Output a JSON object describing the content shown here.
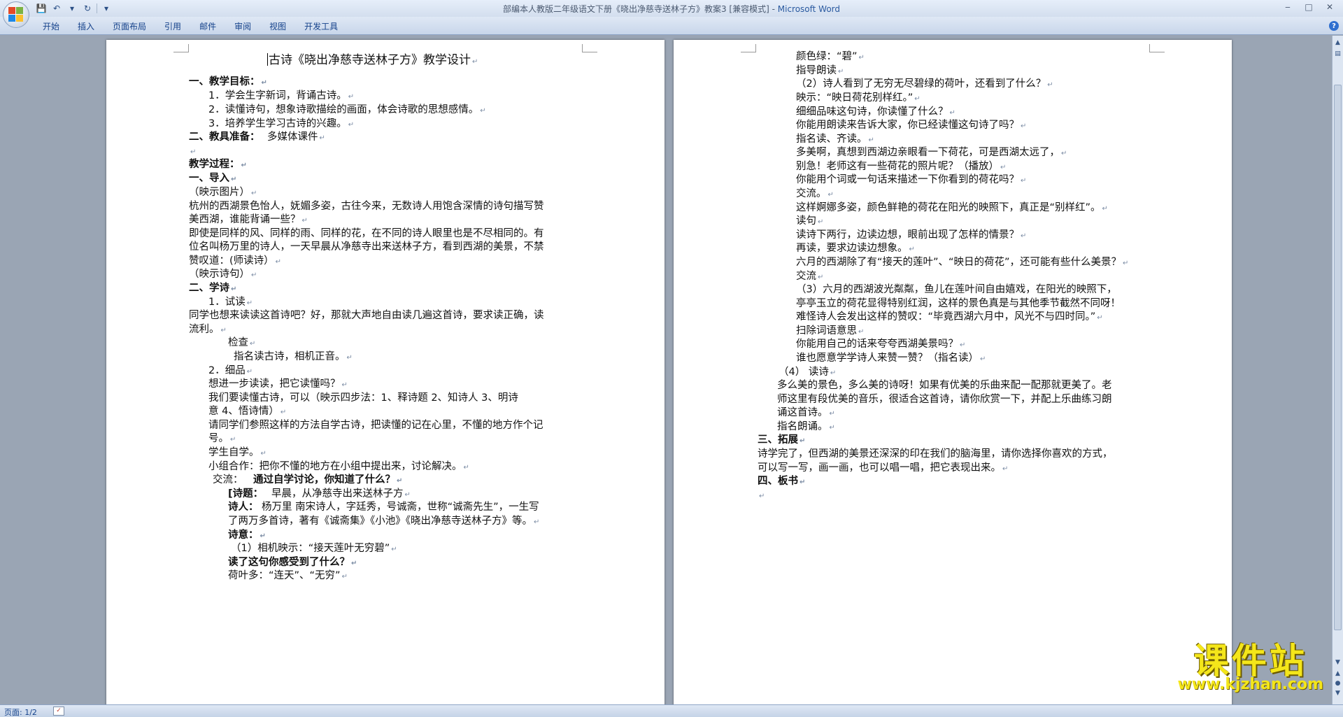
{
  "titlebar": {
    "document": "部编本人教版二年级语文下册《晓出净慈寺送林子方》教案3 [兼容模式]",
    "separator": " - ",
    "app": "Microsoft Word",
    "minimize": "‒",
    "maximize": "□",
    "close": "✕"
  },
  "ribbon": {
    "tabs": [
      "开始",
      "插入",
      "页面布局",
      "引用",
      "邮件",
      "审阅",
      "视图",
      "开发工具"
    ],
    "help": "?"
  },
  "left_page": {
    "title": "古诗《晓出净慈寺送林子方》教学设计",
    "lines": [
      "一、教学目标：",
      "1．学会生字新词，背诵古诗。",
      "2．读懂诗句，想象诗歌描绘的画面，体会诗歌的思想感情。",
      "3．培养学生学习古诗的兴趣。",
      "二、教具准备：",
      "多媒体课件",
      "",
      "教学过程：",
      "一、导入",
      "（映示图片）",
      "杭州的西湖景色怡人，妩媚多姿，古往今来，无数诗人用饱含深情的诗句描写赞",
      "美西湖，谁能背诵一些？",
      "即使是同样的风、同样的雨、同样的花，在不同的诗人眼里也是不尽相同的。有",
      "位名叫杨万里的诗人，一天早晨从净慈寺出来送林子方，看到西湖的美景，不禁",
      "赞叹道：(师读诗）",
      "（映示诗句）",
      "二、学诗",
      "1．试读",
      "同学也想来读读这首诗吧？好，那就大声地自由读几遍这首诗，要求读正确，读",
      "流利。",
      "检查",
      "指名读古诗，相机正音。",
      "2．细品",
      "想进一步读读，把它读懂吗？",
      "我们要读懂古诗，可以（映示四步法：1、释诗题     2、知诗人     3、明诗",
      "意     4、悟诗情）",
      "请同学们参照这样的方法自学古诗，把读懂的记在心里，不懂的地方作个记",
      "号。",
      "学生自学。",
      "小组合作：把你不懂的地方在小组中提出来，讨论解决。",
      "交流：",
      "通过自学讨论，你知道了什么？",
      "[诗题：",
      "早晨，从净慈寺出来送林子方",
      "诗人：",
      "杨万里    南宋诗人，字廷秀，号诚斋，世称“诚斋先生”，一生写",
      "了两万多首诗，著有《诚斋集》《小池》《晓出净慈寺送林子方》等。",
      "诗意：",
      "（1）相机映示：“接天莲叶无穷碧”",
      "读了这句你感受到了什么？",
      "荷叶多：“连天”、“无穷”"
    ]
  },
  "right_page": {
    "lines": [
      "颜色绿：“碧”",
      "指导朗读",
      "（2）诗人看到了无穷无尽碧绿的荷叶，还看到了什么？",
      "映示：“映日荷花别样红。”",
      "细细品味这句诗，你读懂了什么？",
      "你能用朗读来告诉大家，你已经读懂这句诗了吗？",
      "指名读、齐读。",
      "多美啊，真想到西湖边亲眼看一下荷花，可是西湖太远了，",
      "别急！老师这有一些荷花的照片呢？（播放）",
      "你能用个词或一句话来描述一下你看到的荷花吗？",
      "交流。",
      "这样婀娜多姿，颜色鲜艳的荷花在阳光的映照下，真正是“别样红”。",
      "读句",
      "读诗下两行，边读边想，眼前出现了怎样的情景？",
      "再读，要求边读边想象。",
      "六月的西湖除了有“接天的莲叶”、“映日的荷花”，还可能有些什么美景？",
      "交流",
      "（3）六月的西湖波光粼粼，鱼儿在莲叶间自由嬉戏，在阳光的映照下，",
      "亭亭玉立的荷花显得特别红润，这样的景色真是与其他季节截然不同呀！",
      "难怪诗人会发出这样的赞叹：“毕竟西湖六月中，风光不与四时同。”",
      "扫除词语意思",
      "你能用自己的话来夸夸西湖美景吗？",
      "谁也愿意学学诗人来赞一赞？（指名读）",
      "（4）  读诗",
      "多么美的景色，多么美的诗呀！如果有优美的乐曲来配一配那就更美了。老",
      "师这里有段优美的音乐，很适合这首诗，请你欣赏一下，并配上乐曲练习朗",
      "诵这首诗。",
      "指名朗诵。",
      "三、拓展",
      "诗学完了，但西湖的美景还深深的印在我们的脑海里，请你选择你喜欢的方式，",
      "可以写一写，画一画，也可以唱一唱，把它表现出来。",
      "四、板书",
      ""
    ]
  },
  "statusbar": {
    "page": "页面: 1/2"
  },
  "watermark": {
    "big": "课件站",
    "url": "www.kjzhan.com"
  },
  "colors": {
    "background": "#9aa5b4",
    "ribbon_text": "#15428b",
    "watermark": "#f4e61a"
  }
}
